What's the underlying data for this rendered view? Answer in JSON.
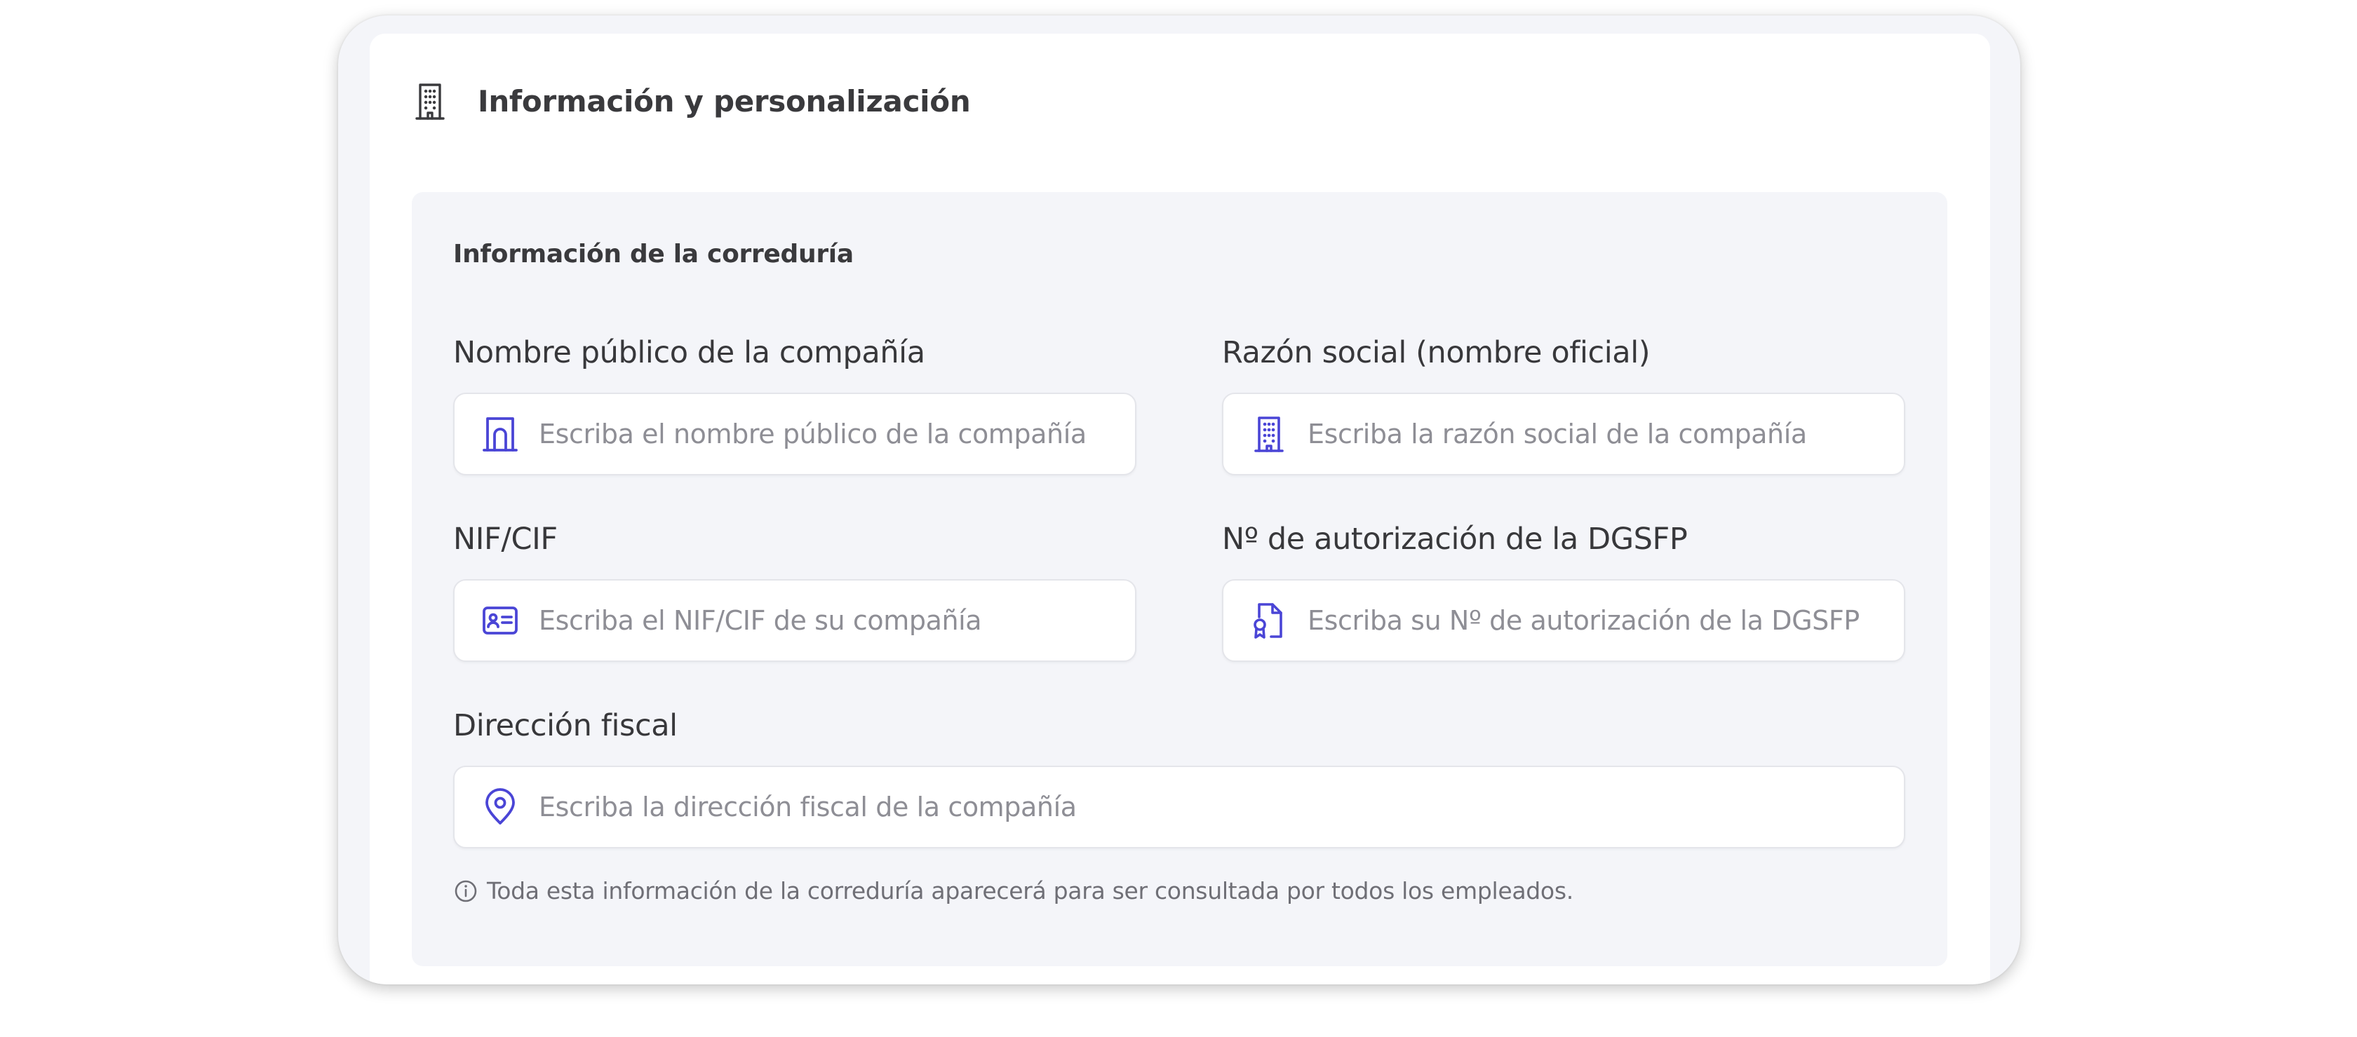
{
  "colors": {
    "accent": "#4a45d6",
    "text": "#38383b",
    "placeholder": "#8e8e95",
    "panel_bg": "#f4f5f9"
  },
  "header": {
    "title": "Información y personalización",
    "icon": "building-icon"
  },
  "section": {
    "title": "Información de la correduría"
  },
  "fields": {
    "public_name": {
      "label": "Nombre público de la compañía",
      "placeholder": "Escriba el nombre público de la compañía",
      "value": "",
      "icon": "storefront-icon"
    },
    "legal_name": {
      "label": "Razón social (nombre oficial)",
      "placeholder": "Escriba la razón social de la compañía",
      "value": "",
      "icon": "building-icon"
    },
    "nif": {
      "label": "NIF/CIF",
      "placeholder": "Escriba el NIF/CIF de su compañía",
      "value": "",
      "icon": "id-card-icon"
    },
    "dgsfp": {
      "label": "Nº de autorización de la DGSFP",
      "placeholder": "Escriba su Nº de autorización de la DGSFP",
      "value": "",
      "icon": "certificate-document-icon"
    },
    "address": {
      "label": "Dirección fiscal",
      "placeholder": "Escriba la dirección fiscal de la compañía",
      "value": "",
      "icon": "map-pin-icon"
    }
  },
  "note": {
    "text": "Toda esta información de la correduría aparecerá para ser consultada por todos los empleados.",
    "icon": "info-icon"
  }
}
